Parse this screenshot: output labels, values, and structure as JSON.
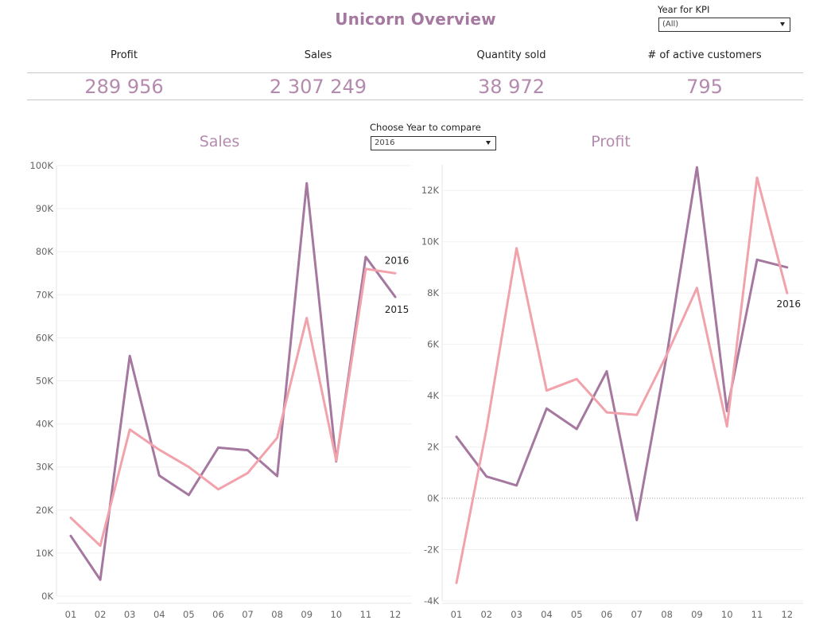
{
  "dashboard": {
    "title": "Unicorn Overview",
    "kpi_filter": {
      "label": "Year for KPI",
      "value": "(All)"
    },
    "compare_filter": {
      "label": "Choose Year to compare",
      "value": "2016"
    }
  },
  "kpis": [
    {
      "label": "Profit",
      "value": "289 956"
    },
    {
      "label": "Sales",
      "value": "2 307 249"
    },
    {
      "label": "Quantity sold",
      "value": "38 972"
    },
    {
      "label": "# of active customers",
      "value": "795"
    }
  ],
  "colors": {
    "accent": "#b48aae",
    "series_2015": "#a5789f",
    "series_2016": "#f1a2ab"
  },
  "chart_data": [
    {
      "type": "line",
      "title": "Sales",
      "categories": [
        "01",
        "02",
        "03",
        "04",
        "05",
        "06",
        "07",
        "08",
        "09",
        "10",
        "11",
        "12"
      ],
      "ylim": [
        0,
        100000
      ],
      "yticks": [
        0,
        10000,
        20000,
        30000,
        40000,
        50000,
        60000,
        70000,
        80000,
        90000,
        100000
      ],
      "ytick_labels": [
        "0K",
        "10K",
        "20K",
        "30K",
        "40K",
        "50K",
        "60K",
        "70K",
        "80K",
        "90K",
        "100K"
      ],
      "grid": true,
      "series": [
        {
          "name": "2015",
          "values": [
            14000,
            3800,
            55800,
            28000,
            23500,
            34500,
            33900,
            27900,
            95900,
            31300,
            78800,
            69500
          ]
        },
        {
          "name": "2016",
          "values": [
            18200,
            11700,
            38700,
            34000,
            30000,
            24800,
            28600,
            36800,
            64600,
            31500,
            76000,
            75000
          ]
        }
      ]
    },
    {
      "type": "line",
      "title": "Profit",
      "categories": [
        "01",
        "02",
        "03",
        "04",
        "05",
        "06",
        "07",
        "08",
        "09",
        "10",
        "11",
        "12"
      ],
      "ylim": [
        -4000,
        13000
      ],
      "yticks": [
        -4000,
        -2000,
        0,
        2000,
        4000,
        6000,
        8000,
        10000,
        12000
      ],
      "ytick_labels": [
        "-4K",
        "-2K",
        "0K",
        "2K",
        "4K",
        "6K",
        "8K",
        "10K",
        "12K"
      ],
      "grid": true,
      "series": [
        {
          "name": "2015",
          "values": [
            2400,
            850,
            500,
            3500,
            2700,
            4950,
            -850,
            5600,
            12900,
            3400,
            9300,
            9000
          ]
        },
        {
          "name": "2016",
          "values": [
            -3300,
            2700,
            9750,
            4200,
            4650,
            3350,
            3250,
            5600,
            8200,
            2800,
            12500,
            8000
          ]
        }
      ]
    }
  ]
}
